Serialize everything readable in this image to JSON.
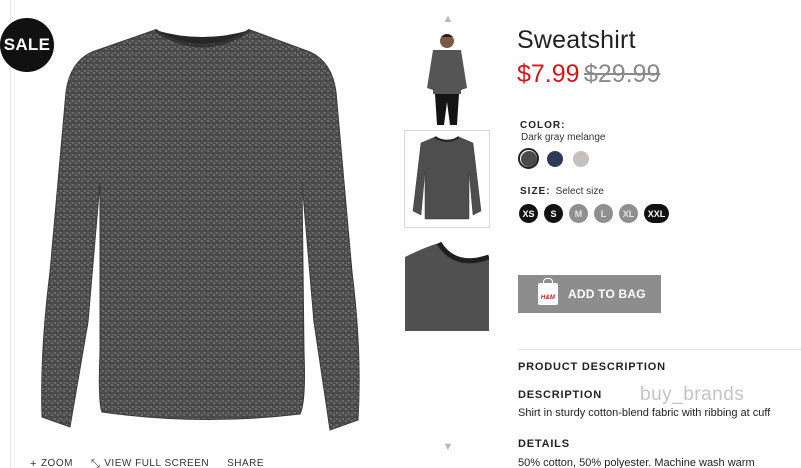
{
  "badge": {
    "label": "SALE"
  },
  "product": {
    "title": "Sweatshirt",
    "price_sale": "$7.99",
    "price_original": "$29.99"
  },
  "color": {
    "label": "COLOR:",
    "selected_name": "Dark gray melange",
    "swatches": [
      {
        "name": "Dark gray melange",
        "color": "#4a4a4a",
        "selected": true
      },
      {
        "name": "Dark blue",
        "color": "#2c3a58",
        "selected": false
      },
      {
        "name": "Light gray",
        "color": "#c4c0bd",
        "selected": false
      }
    ]
  },
  "size": {
    "label": "SIZE:",
    "hint": "Select size",
    "options": [
      {
        "label": "XS",
        "available": true
      },
      {
        "label": "S",
        "available": true
      },
      {
        "label": "M",
        "available": false
      },
      {
        "label": "L",
        "available": false
      },
      {
        "label": "XL",
        "available": false
      },
      {
        "label": "XXL",
        "available": true
      }
    ]
  },
  "add_to_bag": {
    "label": "ADD TO BAG",
    "logo": "H&M",
    "icon": "shopping-bag-icon"
  },
  "info": {
    "section_title": "PRODUCT DESCRIPTION",
    "description_title": "DESCRIPTION",
    "description_text": "Shirt in sturdy cotton-blend fabric with ribbing at cuff",
    "details_title": "DETAILS",
    "details_text": "50% cotton, 50% polyester. Machine wash warm"
  },
  "watermark": "buy_brands",
  "image_actions": [
    {
      "label": "ZOOM",
      "icon": "plus-icon"
    },
    {
      "label": "VIEW FULL SCREEN",
      "icon": "expand-icon"
    },
    {
      "label": "SHARE",
      "icon": ""
    }
  ],
  "thumbnails": [
    {
      "name": "model-view",
      "active": false
    },
    {
      "name": "front-view",
      "active": true
    },
    {
      "name": "collar-detail",
      "active": false
    }
  ],
  "colors": {
    "sale_red": "#d0191f",
    "button_gray": "#8d8d8d",
    "fabric": "#4d4d4d"
  }
}
